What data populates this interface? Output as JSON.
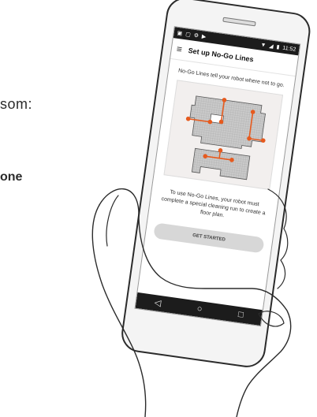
{
  "background": {
    "line1": "som:",
    "line2": "one"
  },
  "status_bar": {
    "time": "11:52",
    "left_icons": [
      "sim-icon",
      "image-icon",
      "settings-icon",
      "play-icon"
    ],
    "right_icons": [
      "wifi-icon",
      "signal-icon",
      "battery-icon"
    ]
  },
  "app_bar": {
    "title": "Set up No-Go Lines",
    "menu_icon": "hamburger-menu-icon"
  },
  "content": {
    "intro": "No-Go Lines tell your robot where not to go.",
    "bottom": "To use No-Go Lines, your robot must complete a special cleaning run to create a floor plan.",
    "cta_label": "GET STARTED"
  },
  "nav_bar": {
    "back_icon": "back-triangle-icon",
    "home_icon": "home-circle-icon",
    "recents_icon": "recents-square-icon"
  },
  "colors": {
    "accent_orange": "#e65a1e",
    "map_gray": "#bdbdbd",
    "button_gray": "#d7d7d7"
  }
}
